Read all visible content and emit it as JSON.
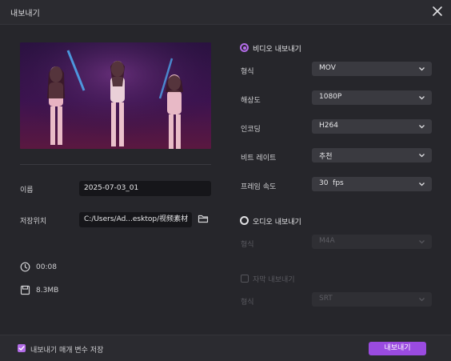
{
  "window": {
    "title": "내보내기"
  },
  "file": {
    "name_label": "이름",
    "name_value": "2025-07-03_01",
    "location_label": "저장위치",
    "location_value": "C:/Users/Ad...esktop/视频素材",
    "duration": "00:08",
    "size": "8.3MB"
  },
  "video": {
    "section_label": "비디오 내보내기",
    "selected": true,
    "rows": [
      {
        "label": "형식",
        "value": "MOV"
      },
      {
        "label": "해상도",
        "value": "1080P"
      },
      {
        "label": "인코딩",
        "value": "H264"
      },
      {
        "label": "비트 레이트",
        "value": "추천"
      },
      {
        "label": "프레임 속도",
        "value": "30  fps"
      }
    ]
  },
  "audio": {
    "section_label": "오디오 내보내기",
    "selected": false,
    "format_label": "형식",
    "format_value": "M4A"
  },
  "subtitle": {
    "checkbox_label": "자막 내보내기",
    "checked": false,
    "format_label": "형식",
    "format_value": "SRT"
  },
  "footer": {
    "remember_label": "내보내기 매개 변수 저장",
    "remember_checked": true,
    "export_label": "내보내기"
  },
  "colors": {
    "accent": "#9a4be0",
    "background": "#26262b",
    "select": "#3a3a40"
  },
  "icons": [
    "close-icon",
    "folder-icon",
    "clock-icon",
    "disk-icon",
    "chevron-down-icon",
    "checkbox-icon",
    "radio-icon"
  ]
}
